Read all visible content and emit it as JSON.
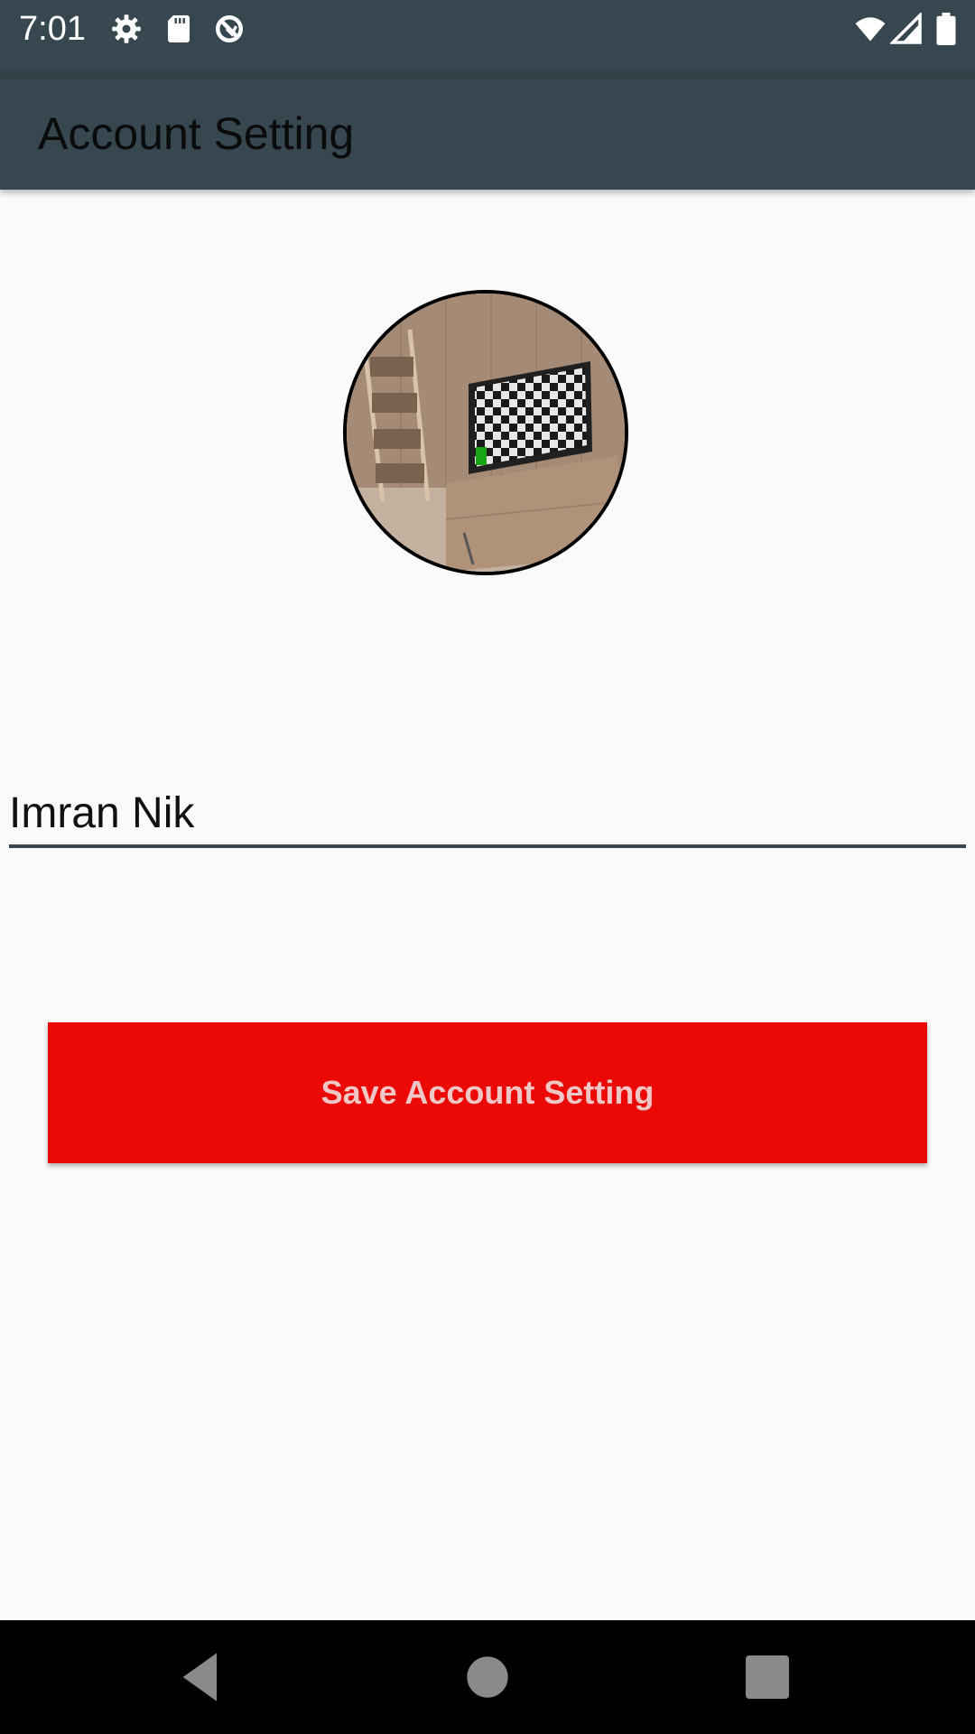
{
  "status_bar": {
    "time": "7:01",
    "icons": [
      "gear-icon",
      "sd-card-icon",
      "sync-icon",
      "wifi-icon",
      "signal-icon",
      "battery-icon"
    ]
  },
  "app_bar": {
    "title": "Account Setting"
  },
  "profile": {
    "avatar": "profile-image"
  },
  "form": {
    "name_value": "Imran Nik"
  },
  "actions": {
    "save_label": "Save Account Setting"
  },
  "navigation": {
    "icons": [
      "back-icon",
      "home-icon",
      "recents-icon"
    ]
  },
  "colors": {
    "status_bar": "#37474f",
    "app_bar": "#37474f",
    "background": "#fafafa",
    "button": "#eb0805",
    "button_text": "#f0c7c6",
    "input_underline": "#37474f"
  }
}
